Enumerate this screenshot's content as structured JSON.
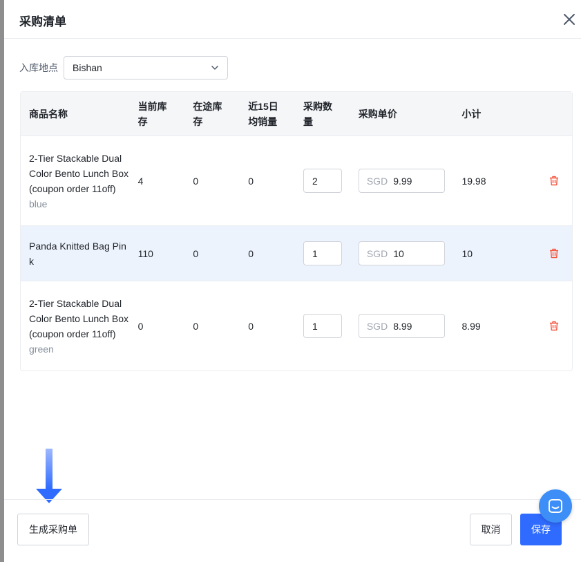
{
  "modal": {
    "title": "采购清单"
  },
  "location": {
    "label": "入库地点",
    "selected": "Bishan"
  },
  "table": {
    "headers": {
      "name": "商品名称",
      "stock": "当前库存",
      "transit": "在途库存",
      "sales": "近15日均销量",
      "qty": "采购数量",
      "price": "采购单价",
      "subtotal": "小计"
    },
    "rows": [
      {
        "name": "2-Tier Stackable Dual Color Bento Lunch Box (coupon order 11off)",
        "variant": "blue",
        "stock": "4",
        "transit": "0",
        "sales": "0",
        "qty": "2",
        "currency": "SGD",
        "price": "9.99",
        "subtotal": "19.98"
      },
      {
        "name": "Panda Knitted Bag Pink",
        "variant": "",
        "stock": "110",
        "transit": "0",
        "sales": "0",
        "qty": "1",
        "currency": "SGD",
        "price": "10",
        "subtotal": "10"
      },
      {
        "name": "2-Tier Stackable Dual Color Bento Lunch Box (coupon order 11off)",
        "variant": "green",
        "stock": "0",
        "transit": "0",
        "sales": "0",
        "qty": "1",
        "currency": "SGD",
        "price": "8.99",
        "subtotal": "8.99"
      }
    ]
  },
  "footer": {
    "generate_label": "生成采购单",
    "cancel_label": "取消",
    "save_label": "保存"
  },
  "colors": {
    "primary": "#2f6bff",
    "delete": "#f5553f",
    "highlight_row": "#edf3fc",
    "arrow": "#2f6bff",
    "chat": "#3d8ef7"
  },
  "icons": {
    "close": "close-icon",
    "dropdown": "chevron-down-icon",
    "delete": "trash-icon",
    "arrow": "arrow-down-icon",
    "chat": "chat-icon"
  }
}
